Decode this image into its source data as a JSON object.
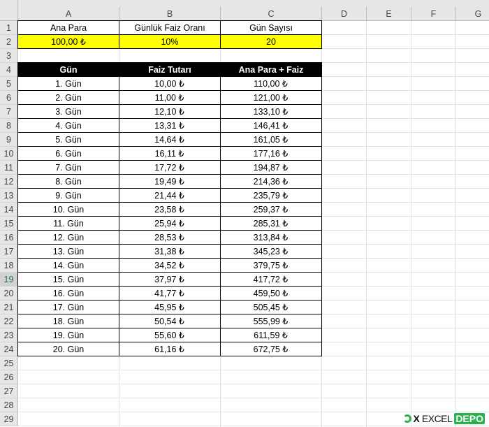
{
  "columns": [
    "A",
    "B",
    "C",
    "D",
    "E",
    "F",
    "G"
  ],
  "rows": [
    "1",
    "2",
    "3",
    "4",
    "5",
    "6",
    "7",
    "8",
    "9",
    "10",
    "11",
    "12",
    "13",
    "14",
    "15",
    "16",
    "17",
    "18",
    "19",
    "20",
    "21",
    "22",
    "23",
    "24",
    "25",
    "26",
    "27",
    "28",
    "29"
  ],
  "active_row": "19",
  "inputs": {
    "headers": [
      "Ana Para",
      "Günlük Faiz Oranı",
      "Gün Sayısı"
    ],
    "values": [
      "100,00 ₺",
      "10%",
      "20"
    ]
  },
  "table": {
    "headers": [
      "Gün",
      "Faiz Tutarı",
      "Ana Para + Faiz"
    ],
    "rows": [
      [
        "1. Gün",
        "10,00 ₺",
        "110,00 ₺"
      ],
      [
        "2. Gün",
        "11,00 ₺",
        "121,00 ₺"
      ],
      [
        "3. Gün",
        "12,10 ₺",
        "133,10 ₺"
      ],
      [
        "4. Gün",
        "13,31 ₺",
        "146,41 ₺"
      ],
      [
        "5. Gün",
        "14,64 ₺",
        "161,05 ₺"
      ],
      [
        "6. Gün",
        "16,11 ₺",
        "177,16 ₺"
      ],
      [
        "7. Gün",
        "17,72 ₺",
        "194,87 ₺"
      ],
      [
        "8. Gün",
        "19,49 ₺",
        "214,36 ₺"
      ],
      [
        "9. Gün",
        "21,44 ₺",
        "235,79 ₺"
      ],
      [
        "10. Gün",
        "23,58 ₺",
        "259,37 ₺"
      ],
      [
        "11. Gün",
        "25,94 ₺",
        "285,31 ₺"
      ],
      [
        "12. Gün",
        "28,53 ₺",
        "313,84 ₺"
      ],
      [
        "13. Gün",
        "31,38 ₺",
        "345,23 ₺"
      ],
      [
        "14. Gün",
        "34,52 ₺",
        "379,75 ₺"
      ],
      [
        "15. Gün",
        "37,97 ₺",
        "417,72 ₺"
      ],
      [
        "16. Gün",
        "41,77 ₺",
        "459,50 ₺"
      ],
      [
        "17. Gün",
        "45,95 ₺",
        "505,45 ₺"
      ],
      [
        "18. Gün",
        "50,54 ₺",
        "555,99 ₺"
      ],
      [
        "19. Gün",
        "55,60 ₺",
        "611,59 ₺"
      ],
      [
        "20. Gün",
        "61,16 ₺",
        "672,75 ₺"
      ]
    ]
  },
  "logo": {
    "x": "X",
    "excel": "EXCEL",
    "depo": "DEPO"
  },
  "colors": {
    "input_fill": "#ffff00",
    "header_fill": "#000000",
    "logo_green": "#2bb24c"
  }
}
